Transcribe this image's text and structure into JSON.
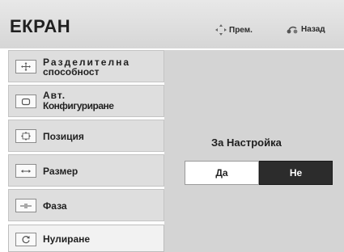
{
  "header": {
    "title": "ЕКРАН",
    "prem_label": "Прем.",
    "back_label": "Назад"
  },
  "sidebar": {
    "items": [
      {
        "label_line1": "Разделителна",
        "label_line2": "способност",
        "icon": "resolution-icon"
      },
      {
        "label_line1": "Авт.",
        "label_line2": "Конфигуриране",
        "icon": "auto-config-icon"
      },
      {
        "label_line1": "Позиция",
        "icon": "position-icon"
      },
      {
        "label_line1": "Размер",
        "icon": "size-icon"
      },
      {
        "label_line1": "Фаза",
        "icon": "phase-icon"
      },
      {
        "label_line1": "Нулиране",
        "icon": "reset-icon",
        "selected": true
      }
    ]
  },
  "dialog": {
    "prompt": "За Настройка",
    "yes_label": "Да",
    "no_label": "Не",
    "selected": "Не"
  },
  "colors": {
    "header_bg": "#dcdcdc",
    "content_bg": "#d4d4d4",
    "selected_button_bg": "#2c2c2c"
  }
}
